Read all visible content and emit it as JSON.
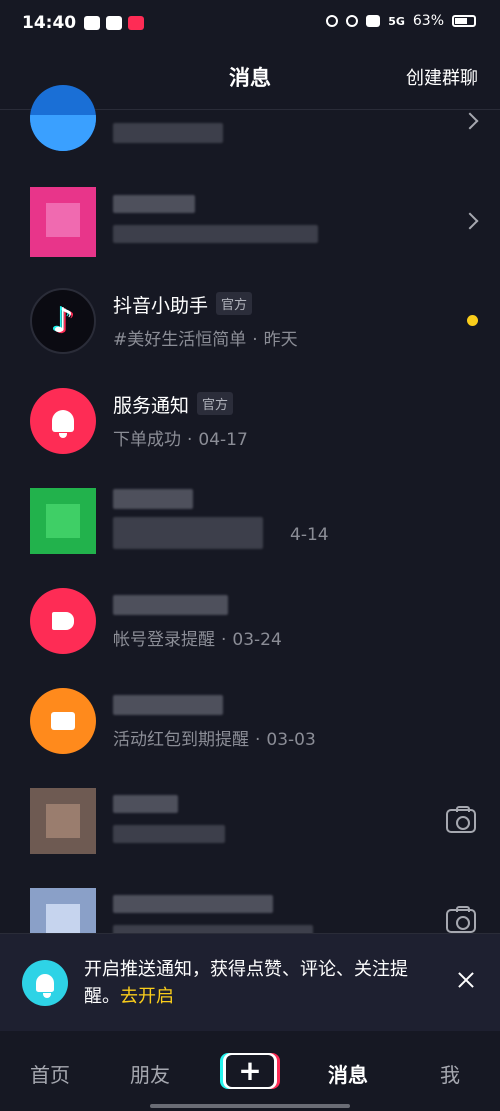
{
  "status_bar": {
    "time": "14:40",
    "network": "5G",
    "battery": "63%"
  },
  "header": {
    "title": "消息",
    "create_group": "创建群聊"
  },
  "conversations": [
    {
      "id": "blurred-1",
      "name": "",
      "sub": "",
      "trailing": "chevron"
    },
    {
      "id": "blurred-2",
      "name": "",
      "sub": "",
      "trailing": "chevron"
    },
    {
      "id": "douyin-assistant",
      "name": "抖音小助手",
      "tag": "官方",
      "preview": "#美好生活恒简单",
      "time": "昨天",
      "trailing": "unread-dot",
      "avatar_color": "#0b0b12"
    },
    {
      "id": "service-notice",
      "name": "服务通知",
      "tag": "官方",
      "preview": "下单成功",
      "time": "04-17",
      "trailing": "none",
      "avatar_color": "#fe2c55"
    },
    {
      "id": "blurred-green",
      "name": "",
      "preview": "",
      "time": "4-14",
      "trailing": "none",
      "avatar_color": "#22b24c"
    },
    {
      "id": "account-notice",
      "name": "",
      "preview": "帐号登录提醒",
      "time": "03-24",
      "trailing": "none",
      "avatar_color": "#fe2c55"
    },
    {
      "id": "wallet-notice",
      "name": "",
      "preview": "活动红包到期提醒",
      "time": "03-03",
      "trailing": "none",
      "avatar_color": "#ff8a1c"
    },
    {
      "id": "blurred-3",
      "name": "",
      "preview": "",
      "trailing": "camera"
    },
    {
      "id": "blurred-4",
      "name": "",
      "preview": "",
      "trailing": "camera"
    }
  ],
  "push_banner": {
    "text": "开启推送通知，获得点赞、评论、关注提醒。",
    "link": "去开启"
  },
  "tabs": [
    {
      "label": "首页",
      "active": false
    },
    {
      "label": "朋友",
      "active": false
    },
    {
      "label": "+",
      "active": false
    },
    {
      "label": "消息",
      "active": true
    },
    {
      "label": "我",
      "active": false
    }
  ],
  "colors": {
    "background": "#161823",
    "accent_yellow": "#facd1b",
    "brand_pink": "#fe2c55",
    "brand_cyan": "#25f4ee"
  }
}
